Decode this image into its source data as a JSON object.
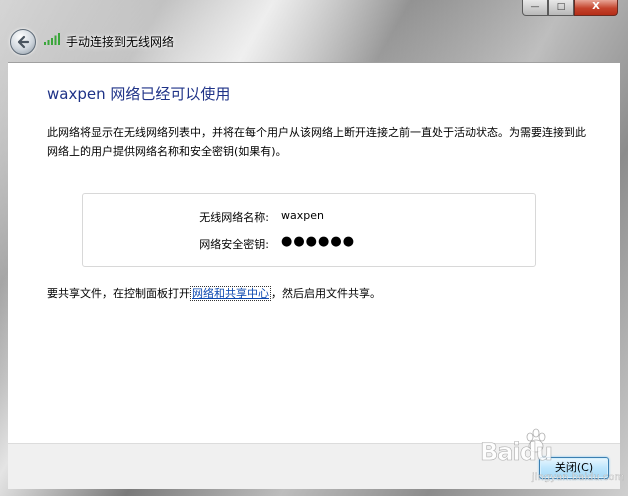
{
  "window": {
    "title": "手动连接到无线网络",
    "controls": {
      "minimize": "—",
      "maximize": "□",
      "close": "X"
    }
  },
  "content": {
    "heading": "waxpen 网络已经可以使用",
    "description": "此网络将显示在无线网络列表中，并将在每个用户从该网络上断开连接之前一直处于活动状态。为需要连接到此网络上的用户提供网络名称和安全密钥(如果有)。",
    "network_name_label": "无线网络名称:",
    "network_name_value": "waxpen",
    "security_key_label": "网络安全密钥:",
    "security_key_value": "●●●●●●",
    "share_prefix": "要共享文件，在控制面板打开",
    "share_link": "网络和共享中心",
    "share_suffix": "，然后启用文件共享。"
  },
  "footer": {
    "close_button": "关闭(C)"
  },
  "watermark": {
    "brand": "Baidu",
    "url": "jingyan.baidu.com"
  },
  "colors": {
    "heading": "#1e3287",
    "link": "#0a47b0",
    "button_border": "#3c7fb1"
  },
  "icons": {
    "back": "back-arrow-icon",
    "signal": "wireless-signal-icon"
  }
}
